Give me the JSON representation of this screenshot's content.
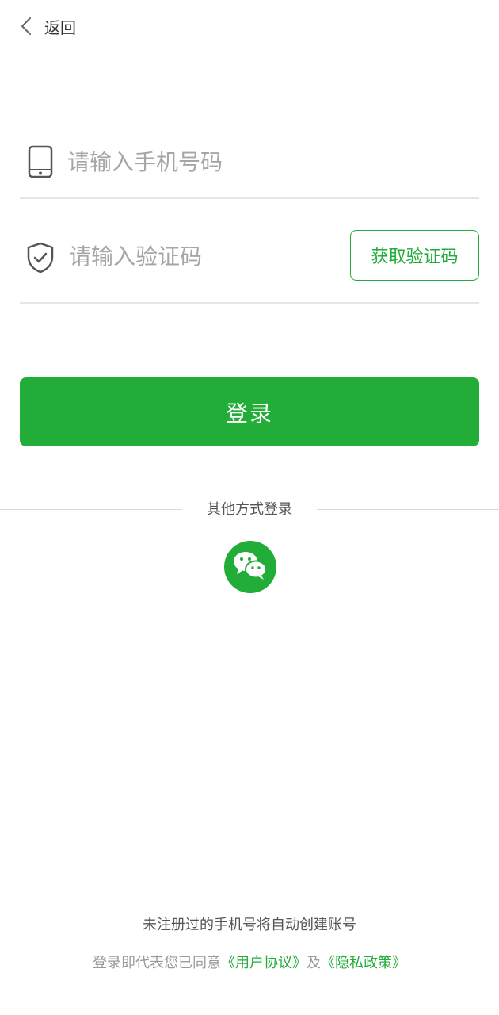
{
  "topbar": {
    "back_label": "返回"
  },
  "phone": {
    "placeholder": "请输入手机号码",
    "value": ""
  },
  "code": {
    "placeholder": "请输入验证码",
    "value": "",
    "get_code_label": "获取验证码"
  },
  "login": {
    "label": "登录"
  },
  "other_login": {
    "label": "其他方式登录",
    "wechat_icon": "wechat-icon"
  },
  "footer": {
    "note": "未注册过的手机号将自动创建账号",
    "agreement_prefix": "登录即代表您已同意",
    "user_agreement": "《用户协议》",
    "conjunction": "及",
    "privacy_policy": "《隐私政策》"
  },
  "colors": {
    "accent": "#22ac38",
    "placeholder": "#a6a6a6",
    "divider": "#e5e5e5"
  }
}
